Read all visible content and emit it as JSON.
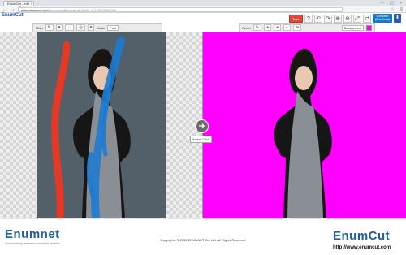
{
  "browser": {
    "tab_title": "EnumCut - edit",
    "url_host": "www.enumcut.com",
    "url_path": "/process/edit?work_id=NUM_20160608000084",
    "nav_glyphs": "← → C"
  },
  "app": {
    "logo_text": "EnumCut",
    "controls": {
      "reset_label": "Reset",
      "help_icon": "?",
      "undo_icon": "↶",
      "redo_icon": "↷",
      "zoom_in_icon": "⊕",
      "zoom_out_icon": "⊖",
      "fit_icon": "⤢",
      "swap_icon": "⇄",
      "complete_label": "Complete",
      "complete_sub": "(Download)",
      "download_icon": "⬇"
    },
    "main_toolbar": {
      "label": "Main",
      "tools": [
        "✎",
        "▾",
        "↔",
        "◎",
        "▾"
      ],
      "mode_label": "Mode",
      "mode_value": "Fast"
    },
    "cutter_toolbar": {
      "label": "Cutter",
      "tools": [
        "✎",
        "●",
        "●",
        "◐",
        "✂"
      ],
      "background_label": "Background",
      "background_color": "#ff00ff"
    }
  },
  "workspace": {
    "active_click_label": "Active Click",
    "arrow_icon": "➜",
    "colors": {
      "keep_stroke": "#1e7bd0",
      "remove_stroke": "#e23a27",
      "result_bg": "#ff00ff"
    }
  },
  "footer": {
    "left_brand": "Enumnet",
    "left_tagline": "Good working, software and useful services",
    "copyright": "Copyrights © 2015 ENUMNET Co. Ltd. All Rights Reserved",
    "right_brand": "EnumCut",
    "right_url": "http://www.enumcut.com"
  }
}
